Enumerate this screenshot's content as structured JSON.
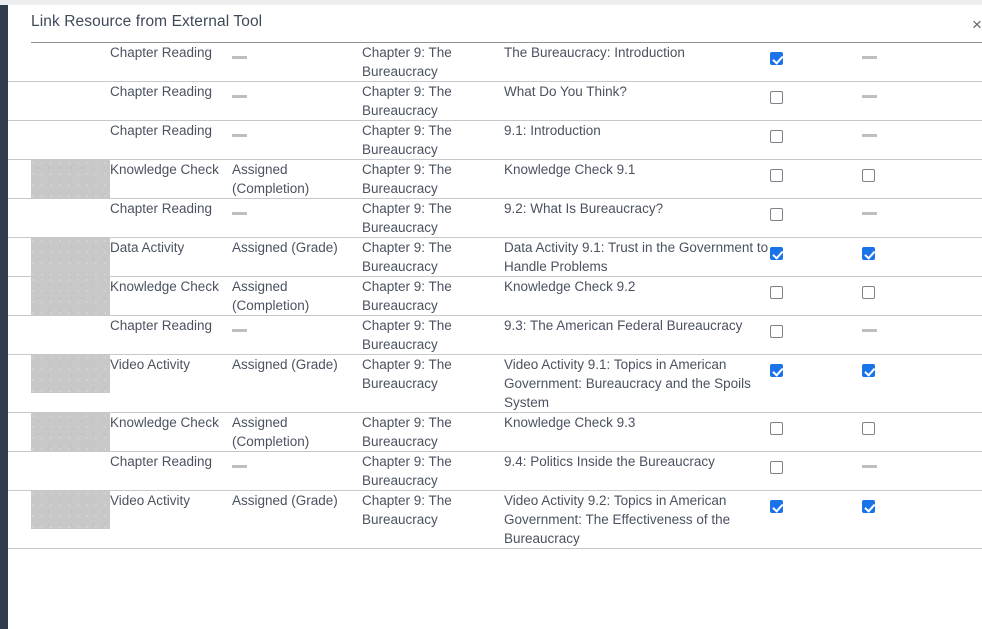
{
  "dialog": {
    "title": "Link Resource from External Tool",
    "close_icon": "close-icon",
    "close_label": "×"
  },
  "table": {
    "dash_placeholder": "—",
    "rows": [
      {
        "thumbnail": false,
        "type": "Chapter Reading",
        "assignment": "—",
        "assignment_is_dash": true,
        "chapter": "Chapter 9: The Bureaucracy",
        "title": "The Bureaucracy: Introduction",
        "checkbox1": "checked",
        "checkbox2": "dash"
      },
      {
        "thumbnail": false,
        "type": "Chapter Reading",
        "assignment": "—",
        "assignment_is_dash": true,
        "chapter": "Chapter 9: The Bureaucracy",
        "title": "What Do You Think?",
        "checkbox1": "unchecked",
        "checkbox2": "dash"
      },
      {
        "thumbnail": false,
        "type": "Chapter Reading",
        "assignment": "—",
        "assignment_is_dash": true,
        "chapter": "Chapter 9: The Bureaucracy",
        "title": "9.1: Introduction",
        "checkbox1": "unchecked",
        "checkbox2": "dash"
      },
      {
        "thumbnail": true,
        "type": "Knowledge Check",
        "assignment": "Assigned (Completion)",
        "assignment_is_dash": false,
        "chapter": "Chapter 9: The Bureaucracy",
        "title": "Knowledge Check 9.1",
        "checkbox1": "unchecked",
        "checkbox2": "unchecked"
      },
      {
        "thumbnail": false,
        "type": "Chapter Reading",
        "assignment": "—",
        "assignment_is_dash": true,
        "chapter": "Chapter 9: The Bureaucracy",
        "title": "9.2: What Is Bureaucracy?",
        "checkbox1": "unchecked",
        "checkbox2": "dash"
      },
      {
        "thumbnail": true,
        "type": "Data Activity",
        "assignment": "Assigned (Grade)",
        "assignment_is_dash": false,
        "chapter": "Chapter 9: The Bureaucracy",
        "title": "Data Activity 9.1: Trust in the Government to Handle Problems",
        "checkbox1": "checked",
        "checkbox2": "checked"
      },
      {
        "thumbnail": true,
        "type": "Knowledge Check",
        "assignment": "Assigned (Completion)",
        "assignment_is_dash": false,
        "chapter": "Chapter 9: The Bureaucracy",
        "title": "Knowledge Check 9.2",
        "checkbox1": "unchecked",
        "checkbox2": "unchecked"
      },
      {
        "thumbnail": false,
        "type": "Chapter Reading",
        "assignment": "—",
        "assignment_is_dash": true,
        "chapter": "Chapter 9: The Bureaucracy",
        "title": "9.3: The American Federal Bureaucracy",
        "checkbox1": "unchecked",
        "checkbox2": "dash"
      },
      {
        "thumbnail": true,
        "type": "Video Activity",
        "assignment": "Assigned (Grade)",
        "assignment_is_dash": false,
        "chapter": "Chapter 9: The Bureaucracy",
        "title": "Video Activity 9.1: Topics in American Government: Bureaucracy and the Spoils System",
        "checkbox1": "checked",
        "checkbox2": "checked"
      },
      {
        "thumbnail": true,
        "type": "Knowledge Check",
        "assignment": "Assigned (Completion)",
        "assignment_is_dash": false,
        "chapter": "Chapter 9: The Bureaucracy",
        "title": "Knowledge Check 9.3",
        "checkbox1": "unchecked",
        "checkbox2": "unchecked"
      },
      {
        "thumbnail": false,
        "type": "Chapter Reading",
        "assignment": "—",
        "assignment_is_dash": true,
        "chapter": "Chapter 9: The Bureaucracy",
        "title": "9.4: Politics Inside the Bureaucracy",
        "checkbox1": "unchecked",
        "checkbox2": "dash"
      },
      {
        "thumbnail": true,
        "type": "Video Activity",
        "assignment": "Assigned (Grade)",
        "assignment_is_dash": false,
        "chapter": "Chapter 9: The Bureaucracy",
        "title": "Video Activity 9.2: Topics in American Government: The Effectiveness of the Bureaucracy",
        "checkbox1": "checked",
        "checkbox2": "checked"
      }
    ]
  },
  "colors": {
    "accent": "#1a73e8",
    "text": "#4a5260",
    "title_text": "#3f4a59",
    "rule": "#c6c9cc",
    "thumbnail": "#c8c8c8",
    "left_rail": "#2f3d4f"
  }
}
